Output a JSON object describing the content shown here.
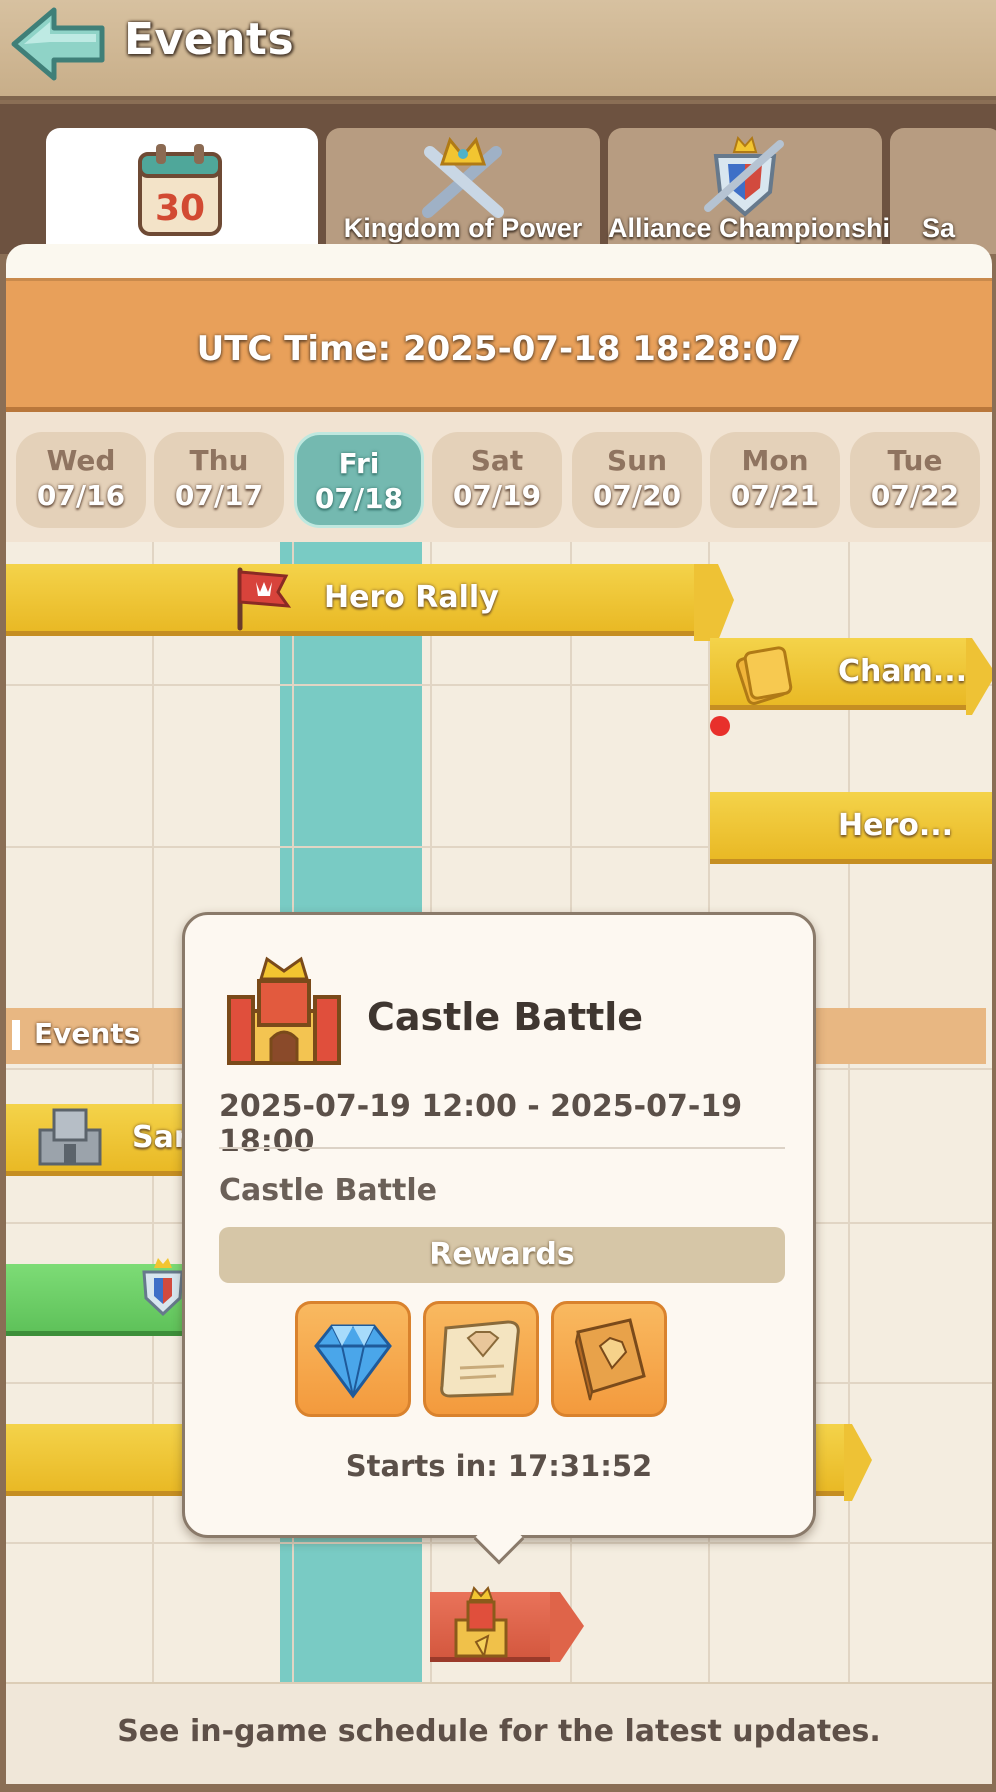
{
  "header": {
    "title": "Events"
  },
  "tabs": [
    {
      "label": "",
      "icon": "calendar-30-icon",
      "active": true
    },
    {
      "label": "Kingdom of Power",
      "icon": "crossed-swords-crown-icon"
    },
    {
      "label": "Alliance Championship",
      "icon": "shield-swords-icon"
    },
    {
      "label": "Sa",
      "icon": ""
    }
  ],
  "calendar_icon_number": "30",
  "utc": {
    "text": "UTC Time:  2025-07-18 18:28:07"
  },
  "days": [
    {
      "name": "Wed",
      "date": "07/16"
    },
    {
      "name": "Thu",
      "date": "07/17"
    },
    {
      "name": "Fri",
      "date": "07/18",
      "active": true
    },
    {
      "name": "Sat",
      "date": "07/19"
    },
    {
      "name": "Sun",
      "date": "07/20"
    },
    {
      "name": "Mon",
      "date": "07/21"
    },
    {
      "name": "Tue",
      "date": "07/22"
    }
  ],
  "timeline": {
    "hero_rally": "Hero Rally",
    "champ_short": "Cham...",
    "hero_short": "Hero...",
    "section_label": "Events",
    "san_short": "Sar"
  },
  "popup": {
    "title": "Castle Battle",
    "time_range": "2025-07-19 12:00 - 2025-07-19 18:00",
    "description": "Castle Battle",
    "rewards_label": "Rewards",
    "rewards": [
      "diamond-icon",
      "scroll-icon",
      "book-icon"
    ],
    "starts_in": "Starts in: 17:31:52"
  },
  "footer": {
    "text": "See in-game schedule for the latest updates."
  },
  "colors": {
    "today_column": "#79cbc4",
    "utc_bar": "#e8a05a",
    "event_bar": "#f0c83a",
    "green_bar": "#6cc96a",
    "red_bar": "#d9624a"
  }
}
